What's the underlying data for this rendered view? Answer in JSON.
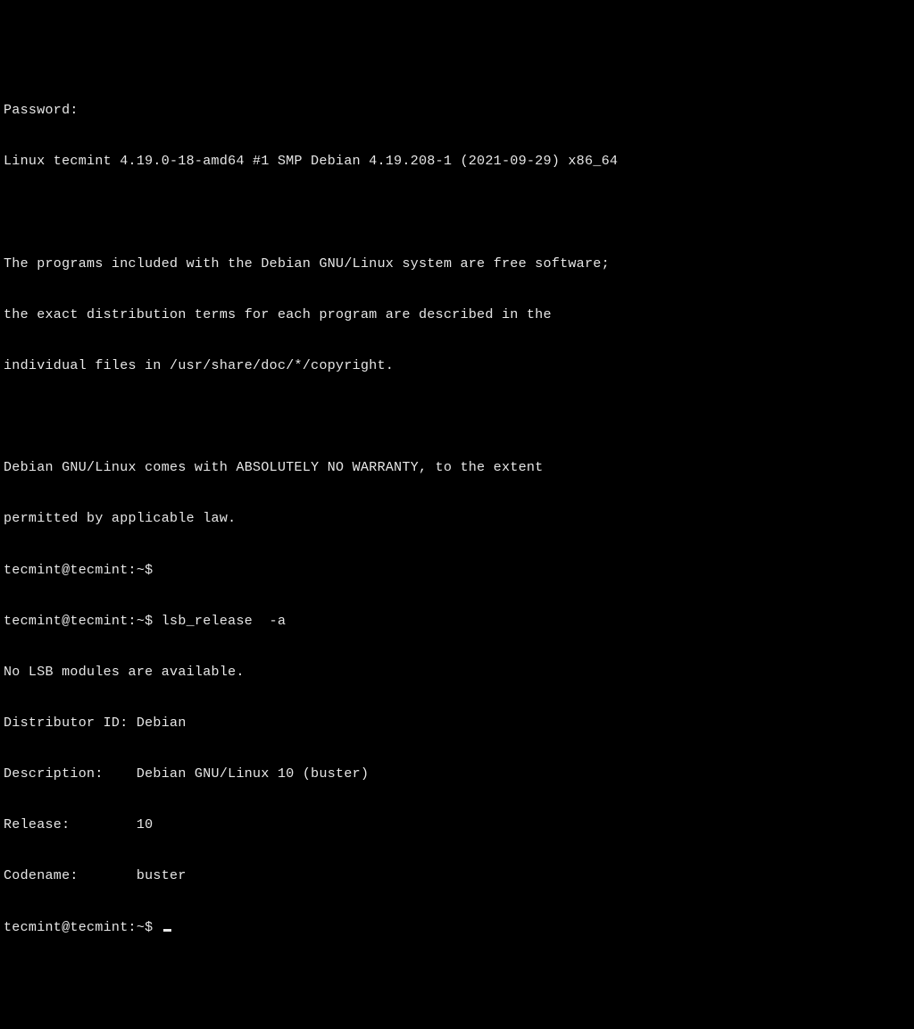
{
  "terminal": {
    "lines": [
      "Password:",
      "Linux tecmint 4.19.0-18-amd64 #1 SMP Debian 4.19.208-1 (2021-09-29) x86_64",
      "",
      "The programs included with the Debian GNU/Linux system are free software;",
      "the exact distribution terms for each program are described in the",
      "individual files in /usr/share/doc/*/copyright.",
      "",
      "Debian GNU/Linux comes with ABSOLUTELY NO WARRANTY, to the extent",
      "permitted by applicable law.",
      "tecmint@tecmint:~$",
      "tecmint@tecmint:~$ lsb_release  -a",
      "No LSB modules are available.",
      "Distributor ID: Debian",
      "Description:    Debian GNU/Linux 10 (buster)",
      "Release:        10",
      "Codename:       buster"
    ],
    "prompt_final": "tecmint@tecmint:~$ "
  }
}
